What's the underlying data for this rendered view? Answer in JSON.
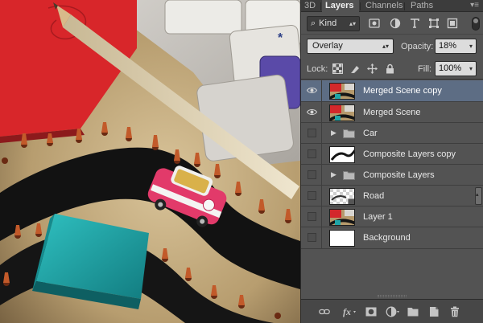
{
  "panel": {
    "tabs": [
      {
        "label": "3D",
        "active": false
      },
      {
        "label": "Layers",
        "active": true
      },
      {
        "label": "Channels",
        "active": false
      },
      {
        "label": "Paths",
        "active": false
      }
    ],
    "menu_glyph": "▾≡"
  },
  "filter": {
    "kind_label": "Kind",
    "kind_glyph": "⌕",
    "icons": [
      "image-filter-icon",
      "adjustment-filter-icon",
      "type-filter-icon",
      "shape-filter-icon",
      "smart-object-filter-icon"
    ]
  },
  "blend": {
    "mode": "Overlay",
    "opacity_label": "Opacity:",
    "opacity_value": "18%",
    "fill_label": "Fill:",
    "fill_value": "100%"
  },
  "lock": {
    "label": "Lock:",
    "icons": [
      "lock-transparent-pixels-icon",
      "lock-image-pixels-icon",
      "lock-position-icon",
      "lock-all-icon"
    ]
  },
  "layers": [
    {
      "name": "Merged Scene copy",
      "visible": true,
      "selected": true,
      "kind": "pixel",
      "thumb": "scene"
    },
    {
      "name": "Merged Scene",
      "visible": true,
      "selected": false,
      "kind": "pixel",
      "thumb": "scene"
    },
    {
      "name": "Car",
      "visible": false,
      "selected": false,
      "kind": "group"
    },
    {
      "name": "Composite Layers copy",
      "visible": false,
      "selected": false,
      "kind": "pixel",
      "thumb": "road"
    },
    {
      "name": "Composite Layers",
      "visible": false,
      "selected": false,
      "kind": "group"
    },
    {
      "name": "Road",
      "visible": false,
      "selected": false,
      "kind": "smart",
      "thumb": "checker"
    },
    {
      "name": "Layer 1",
      "visible": false,
      "selected": false,
      "kind": "pixel",
      "thumb": "scene"
    },
    {
      "name": "Background",
      "visible": false,
      "selected": false,
      "kind": "pixel",
      "thumb": "white"
    }
  ],
  "bottom_icons": [
    "link-layers-icon",
    "fx-icon",
    "add-mask-icon",
    "adjustment-layer-icon",
    "new-group-icon",
    "new-layer-icon",
    "trash-icon"
  ],
  "colors": {
    "panel_bg": "#535353",
    "selected_row": "#5d6d84",
    "red_paper": "#d8262a",
    "teal_block": "#1fa4a6",
    "car_pink": "#e23a6a"
  }
}
